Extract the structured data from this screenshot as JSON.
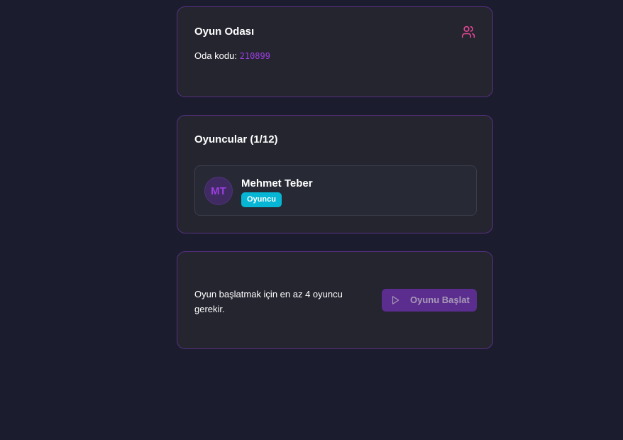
{
  "room": {
    "title": "Oyun Odası",
    "code_label": "Oda kodu:",
    "code_value": "210899",
    "icon": "users-icon"
  },
  "players": {
    "title": "Oyuncular (1/12)",
    "items": [
      {
        "initials": "MT",
        "name": "Mehmet Teber",
        "role": "Oyuncu"
      }
    ]
  },
  "start": {
    "hint": "Oyun başlatmak için en az 4 oyuncu gerekir.",
    "button_label": "Oyunu Başlat",
    "button_icon": "play-icon",
    "button_disabled": true
  },
  "colors": {
    "background": "#1c1c2f",
    "card": "#252530",
    "card_border": "#56307f",
    "accent_purple": "#9b3fe0",
    "badge_cyan": "#06b6d4",
    "icon_pink": "#ec4899",
    "button_disabled": "#5b2d8e"
  }
}
